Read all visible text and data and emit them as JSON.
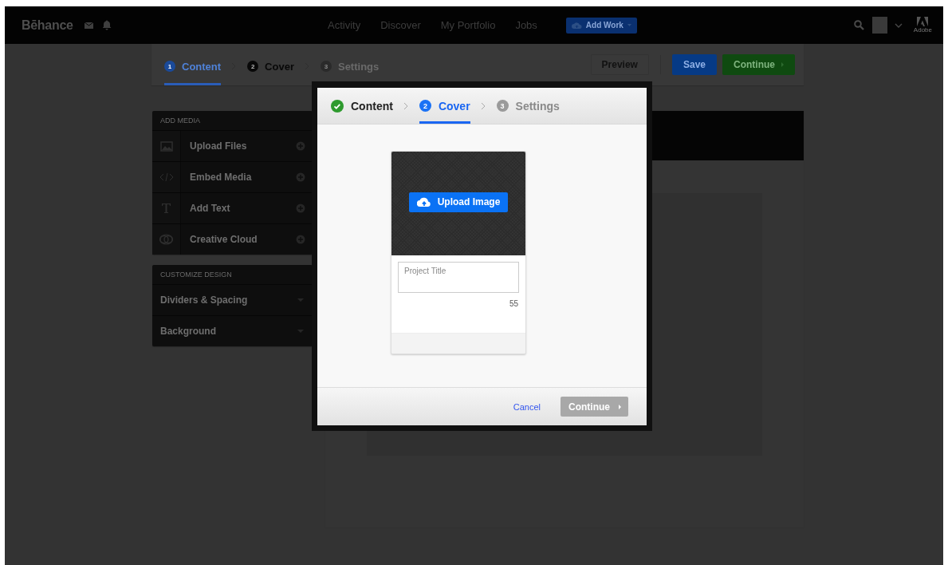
{
  "topbar": {
    "logo": "Bēhance",
    "nav": [
      {
        "label": "Activity"
      },
      {
        "label": "Discover"
      },
      {
        "label": "My Portfolio"
      },
      {
        "label": "Jobs"
      }
    ],
    "add_work": "Add Work",
    "adobe_label": "Adobe"
  },
  "steps": [
    {
      "number": "1",
      "label": "Content",
      "selected": true,
      "disabled": false
    },
    {
      "number": "2",
      "label": "Cover",
      "selected": false,
      "disabled": false
    },
    {
      "number": "3",
      "label": "Settings",
      "selected": false,
      "disabled": true
    }
  ],
  "actions": [
    {
      "label": "Preview",
      "kind": "plain"
    },
    {
      "label": "Save",
      "kind": "primary"
    },
    {
      "label": "Continue",
      "kind": "go"
    }
  ],
  "sidebar": {
    "add_media": {
      "title": "ADD MEDIA",
      "items": [
        {
          "label": "Upload Files"
        },
        {
          "label": "Embed Media"
        },
        {
          "label": "Add Text"
        },
        {
          "label": "Creative Cloud"
        }
      ]
    },
    "customize": {
      "title": "CUSTOMIZE DESIGN",
      "items": [
        {
          "label": "Dividers & Spacing"
        },
        {
          "label": "Background"
        }
      ]
    }
  },
  "modal": {
    "steps": [
      {
        "label": "Content",
        "done": true,
        "selected": false,
        "disabled": false
      },
      {
        "number": "2",
        "label": "Cover",
        "done": false,
        "selected": true,
        "disabled": false
      },
      {
        "number": "3",
        "label": "Settings",
        "done": false,
        "selected": false,
        "disabled": true
      }
    ],
    "card": {
      "upload_button": "Upload Image",
      "title_placeholder": "Project Title",
      "counter": "55"
    },
    "footer": {
      "cancel": "Cancel",
      "continue": {
        "label": "Continue",
        "disabled": true
      }
    }
  }
}
